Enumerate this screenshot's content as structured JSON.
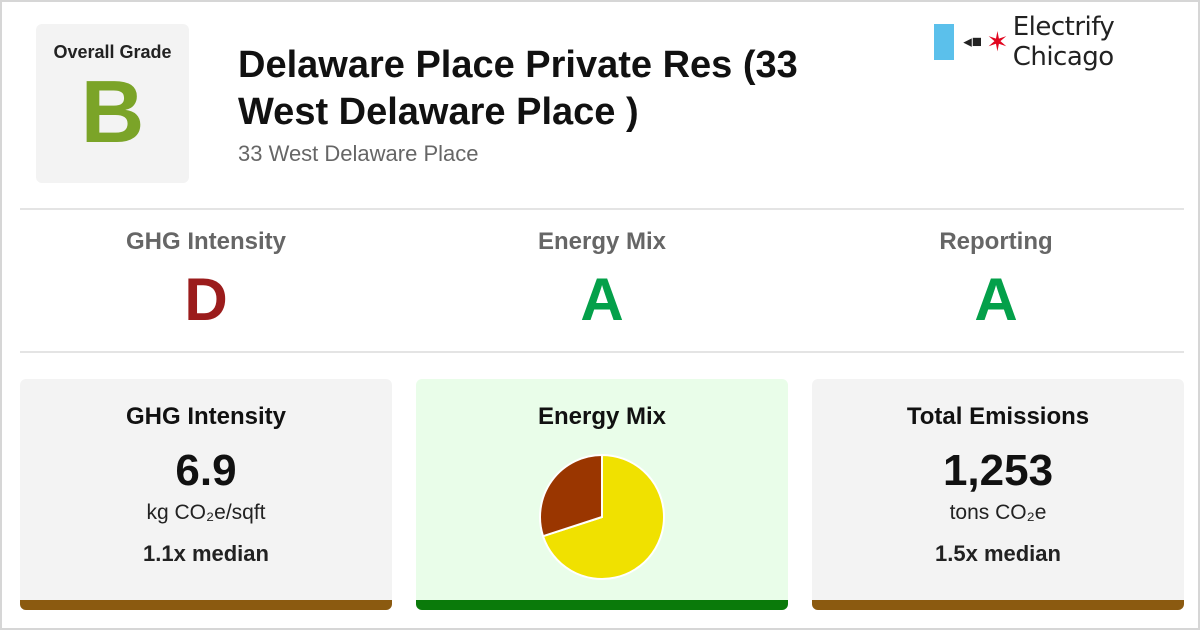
{
  "brand": {
    "name": "Electrify Chicago",
    "flag_color": "#5bc0eb",
    "plug_glyph": "◂■",
    "star_glyph": "✶",
    "star_color": "#e1061f"
  },
  "overall": {
    "label": "Overall Grade",
    "grade": "B",
    "grade_color": "#7ba428"
  },
  "building": {
    "title": "Delaware Place Private Res (33 West Delaware Place )",
    "address": "33 West Delaware Place"
  },
  "grades": [
    {
      "label": "GHG Intensity",
      "grade": "D",
      "color": "#9b1c1c"
    },
    {
      "label": "Energy Mix",
      "grade": "A",
      "color": "#04a04a"
    },
    {
      "label": "Reporting",
      "grade": "A",
      "color": "#04a04a"
    }
  ],
  "cards": [
    {
      "title": "GHG Intensity",
      "value": "6.9",
      "unit": "kg CO₂e/sqft",
      "median": "1.1x median",
      "background": "#f3f3f3",
      "bar_color": "#8b5a10"
    },
    {
      "title": "Energy Mix",
      "background": "#e9fde9",
      "bar_color": "#0a7a0a"
    },
    {
      "title": "Total Emissions",
      "value": "1,253",
      "unit": "tons CO₂e",
      "median": "1.5x median",
      "background": "#f3f3f3",
      "bar_color": "#8b5a10"
    }
  ],
  "chart_data": {
    "type": "pie",
    "values": [
      70,
      30
    ],
    "colors": [
      "#f0e100",
      "#9a3600"
    ]
  }
}
